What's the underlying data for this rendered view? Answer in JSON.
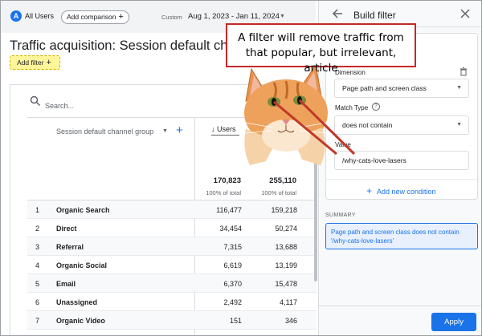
{
  "topbar": {
    "segment_badge": "A",
    "segment_label": "All Users",
    "compare_label": "Add comparison",
    "custom_label": "Custom",
    "date_range": "Aug 1, 2023 - Jan 11, 2024"
  },
  "report": {
    "title": "Traffic acquisition: Session default channel",
    "add_filter_label": "Add filter"
  },
  "table": {
    "search_placeholder": "Search...",
    "dimension_header": "Session default channel group",
    "users_header": "Users",
    "totals": {
      "users": "170,823",
      "sessions": "255,110"
    },
    "totals_pct": {
      "users": "100% of total",
      "sessions": "100% of total"
    },
    "rows": [
      {
        "index": "1",
        "channel": "Organic Search",
        "users": "116,477",
        "sessions": "159,218"
      },
      {
        "index": "2",
        "channel": "Direct",
        "users": "34,454",
        "sessions": "50,274"
      },
      {
        "index": "3",
        "channel": "Referral",
        "users": "7,315",
        "sessions": "13,688"
      },
      {
        "index": "4",
        "channel": "Organic Social",
        "users": "6,619",
        "sessions": "13,199"
      },
      {
        "index": "5",
        "channel": "Email",
        "users": "6,370",
        "sessions": "15,478"
      },
      {
        "index": "6",
        "channel": "Unassigned",
        "users": "2,492",
        "sessions": "4,117"
      },
      {
        "index": "7",
        "channel": "Organic Video",
        "users": "151",
        "sessions": "346"
      }
    ]
  },
  "panel": {
    "title": "Build filter",
    "dimension_label": "Dimension",
    "dimension_value": "Page path and screen class",
    "match_type_label": "Match Type",
    "match_type_value": "does not contain",
    "value_label": "Value",
    "value_input": "/why-cats-love-lasers",
    "add_condition_label": "Add new condition",
    "summary_label": "SUMMARY",
    "summary_text": "Page path and screen class does not contain '/why-cats-love-lasers'",
    "apply_label": "Apply"
  },
  "callout": {
    "line1": "A filter will remove traffic from",
    "line2": "that popular, but irrelevant, article"
  },
  "colors": {
    "accent": "#1a73e8",
    "highlight": "#fff59a",
    "callout_border": "#c62828",
    "laser": "#c0392b"
  }
}
